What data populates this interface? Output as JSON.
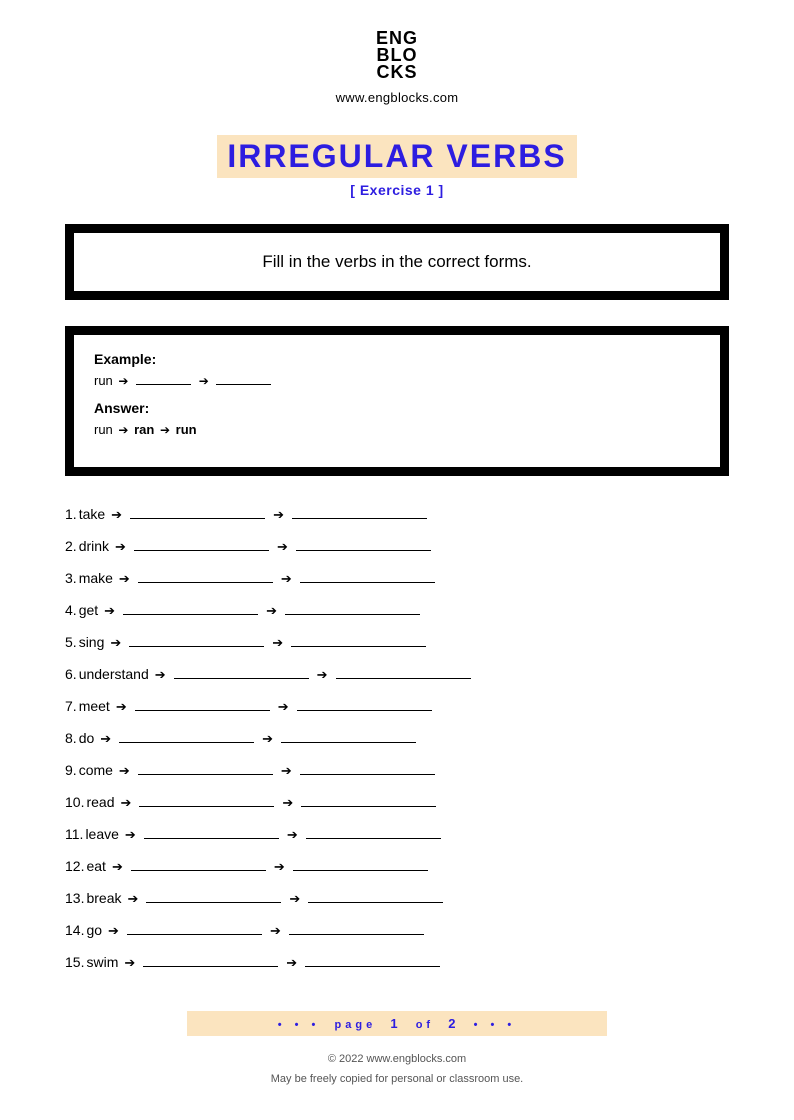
{
  "header": {
    "logo_l1": "ENG",
    "logo_l2": "BLO",
    "logo_l3": "CKS",
    "site": "www.engblocks.com"
  },
  "title": "IRREGULAR VERBS",
  "subtitle": "[ Exercise 1 ]",
  "instruction": "Fill in the verbs in the correct forms.",
  "example": {
    "label": "Example:",
    "verb": "run",
    "answer_label": "Answer:",
    "answer_line": "run ➔ ran ➔ run",
    "ans_v": "run",
    "ans_p1": "ran",
    "ans_p2": "run"
  },
  "items": [
    {
      "n": "1.",
      "verb": "take"
    },
    {
      "n": "2.",
      "verb": "drink"
    },
    {
      "n": "3.",
      "verb": "make"
    },
    {
      "n": "4.",
      "verb": "get"
    },
    {
      "n": "5.",
      "verb": "sing"
    },
    {
      "n": "6.",
      "verb": "understand"
    },
    {
      "n": "7.",
      "verb": "meet"
    },
    {
      "n": "8.",
      "verb": "do"
    },
    {
      "n": "9.",
      "verb": "come"
    },
    {
      "n": "10.",
      "verb": "read"
    },
    {
      "n": "11.",
      "verb": "leave"
    },
    {
      "n": "12.",
      "verb": "eat"
    },
    {
      "n": "13.",
      "verb": "break"
    },
    {
      "n": "14.",
      "verb": "go"
    },
    {
      "n": "15.",
      "verb": "swim"
    }
  ],
  "pager": {
    "dots_l": "• • •",
    "label_page": "page",
    "current": "1",
    "label_of": "of",
    "total": "2",
    "dots_r": "• • •"
  },
  "footer": {
    "copyright": "© 2022 www.engblocks.com",
    "license": "May be freely copied for personal or classroom use."
  }
}
